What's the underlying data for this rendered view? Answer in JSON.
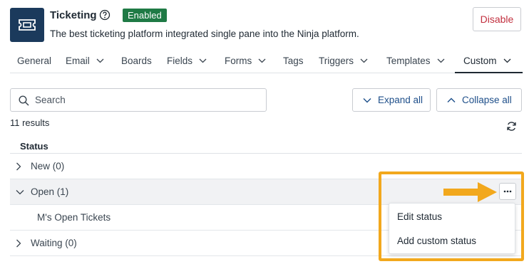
{
  "header": {
    "title": "Ticketing",
    "help_icon": "question-circle-icon",
    "app_icon": "ticket-icon",
    "status_badge": "Enabled",
    "description": "The best ticketing platform integrated single pane into the Ninja platform.",
    "disable_label": "Disable"
  },
  "tabs": [
    {
      "label": "General",
      "dropdown": false
    },
    {
      "label": "Email",
      "dropdown": true
    },
    {
      "label": "Boards",
      "dropdown": false
    },
    {
      "label": "Fields",
      "dropdown": true
    },
    {
      "label": "Forms",
      "dropdown": true
    },
    {
      "label": "Tags",
      "dropdown": false
    },
    {
      "label": "Triggers",
      "dropdown": true
    },
    {
      "label": "Templates",
      "dropdown": true
    },
    {
      "label": "Custom",
      "dropdown": true,
      "active": true
    }
  ],
  "toolbar": {
    "search_placeholder": "Search",
    "expand_all": "Expand all",
    "collapse_all": "Collapse all"
  },
  "results_count": "11 results",
  "table": {
    "column_header": "Status",
    "rows": [
      {
        "label": "New (0)",
        "expanded": false
      },
      {
        "label": "Open (1)",
        "expanded": true
      },
      {
        "label": "M's Open Tickets",
        "child": true
      },
      {
        "label": "Waiting (0)",
        "expanded": false
      }
    ]
  },
  "context_menu": {
    "items": [
      "Edit status",
      "Add custom status"
    ]
  },
  "colors": {
    "brand_navy": "#1b3a5c",
    "enabled_green": "#1f7a45",
    "disable_red": "#c2303f",
    "link_blue": "#1e4f8a",
    "annotation_orange": "#f2a81d"
  }
}
